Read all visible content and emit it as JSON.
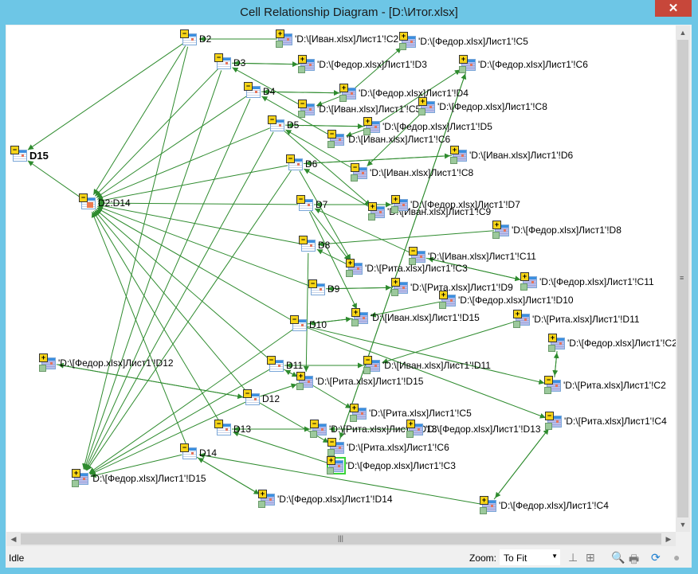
{
  "window": {
    "title": "Cell Relationship Diagram - [D:\\Итог.xlsx]",
    "close_label": "✕"
  },
  "colors": {
    "edge": "#2e8b2e",
    "titlebar": "#6dc6e6",
    "close": "#c7473a",
    "selection": "#3ad43a"
  },
  "nodes": [
    {
      "id": "D2",
      "label": "D2",
      "type": "local",
      "toggle": "−"
    },
    {
      "id": "IC2",
      "label": "'D:\\[Иван.xlsx]Лист1'!C2",
      "type": "ext",
      "toggle": "+"
    },
    {
      "id": "FC5",
      "label": "'D:\\[Федор.xlsx]Лист1'!C5",
      "type": "ext",
      "toggle": "+"
    },
    {
      "id": "D3",
      "label": "D3",
      "type": "local",
      "toggle": "−"
    },
    {
      "id": "FD3",
      "label": "'D:\\[Федор.xlsx]Лист1'!D3",
      "type": "ext",
      "toggle": "+"
    },
    {
      "id": "FC6",
      "label": "'D:\\[Федор.xlsx]Лист1'!C6",
      "type": "ext",
      "toggle": "+"
    },
    {
      "id": "D4",
      "label": "D4",
      "type": "local",
      "toggle": "−"
    },
    {
      "id": "FD4",
      "label": "'D:\\[Федор.xlsx]Лист1'!D4",
      "type": "ext",
      "toggle": "+"
    },
    {
      "id": "IC5",
      "label": "'D:\\[Иван.xlsx]Лист1'!C5",
      "type": "ext",
      "toggle": "−"
    },
    {
      "id": "FC8",
      "label": "'D:\\[Федор.xlsx]Лист1'!C8",
      "type": "ext",
      "toggle": "+"
    },
    {
      "id": "D5",
      "label": "D5",
      "type": "local",
      "toggle": "−"
    },
    {
      "id": "FD5",
      "label": "'D:\\[Федор.xlsx]Лист1'!D5",
      "type": "ext",
      "toggle": "+"
    },
    {
      "id": "IC6",
      "label": "'D:\\[Иван.xlsx]Лист1'!C6",
      "type": "ext",
      "toggle": "−"
    },
    {
      "id": "ID6",
      "label": "'D:\\[Иван.xlsx]Лист1'!D6",
      "type": "ext",
      "toggle": "+"
    },
    {
      "id": "D15",
      "label": "D15",
      "type": "root",
      "toggle": "−"
    },
    {
      "id": "D6",
      "label": "D6",
      "type": "local",
      "toggle": "−"
    },
    {
      "id": "IC8",
      "label": "'D:\\[Иван.xlsx]Лист1'!C8",
      "type": "ext",
      "toggle": "−"
    },
    {
      "id": "R",
      "label": "D2:D14",
      "type": "range",
      "toggle": "−"
    },
    {
      "id": "D7",
      "label": "D7",
      "type": "local",
      "toggle": "−"
    },
    {
      "id": "IC9",
      "label": "'D:\\[Иван.xlsx]Лист1'!C9",
      "type": "ext",
      "toggle": "+"
    },
    {
      "id": "FD7",
      "label": "'D:\\[Федор.xlsx]Лист1'!D7",
      "type": "ext",
      "toggle": "+"
    },
    {
      "id": "FD8",
      "label": "'D:\\[Федор.xlsx]Лист1'!D8",
      "type": "ext",
      "toggle": "+"
    },
    {
      "id": "D8",
      "label": "D8",
      "type": "local",
      "toggle": "−"
    },
    {
      "id": "IC11",
      "label": "'D:\\[Иван.xlsx]Лист1'!C11",
      "type": "ext",
      "toggle": "−"
    },
    {
      "id": "RC3",
      "label": "'D:\\[Рита.xlsx]Лист1'!C3",
      "type": "ext",
      "toggle": "+"
    },
    {
      "id": "FC11",
      "label": "'D:\\[Федор.xlsx]Лист1'!C11",
      "type": "ext",
      "toggle": "+"
    },
    {
      "id": "D9",
      "label": "D9",
      "type": "local",
      "toggle": "−"
    },
    {
      "id": "RD9",
      "label": "'D:\\[Рита.xlsx]Лист1'!D9",
      "type": "ext",
      "toggle": "+"
    },
    {
      "id": "FD10",
      "label": "'D:\\[Федор.xlsx]Лист1'!D10",
      "type": "ext",
      "toggle": "+"
    },
    {
      "id": "ID15",
      "label": "'D:\\[Иван.xlsx]Лист1'!D15",
      "type": "ext",
      "toggle": "+"
    },
    {
      "id": "D10",
      "label": "D10",
      "type": "local",
      "toggle": "−"
    },
    {
      "id": "RD11",
      "label": "'D:\\[Рита.xlsx]Лист1'!D11",
      "type": "ext",
      "toggle": "+"
    },
    {
      "id": "FC2",
      "label": "'D:\\[Федор.xlsx]Лист1'!C2",
      "type": "ext",
      "toggle": "+"
    },
    {
      "id": "FD12",
      "label": "'D:\\[Федор.xlsx]Лист1'!D12",
      "type": "ext",
      "toggle": "+"
    },
    {
      "id": "D11",
      "label": "D11",
      "type": "local",
      "toggle": "−"
    },
    {
      "id": "ID11",
      "label": "'D:\\[Иван.xlsx]Лист1'!D11",
      "type": "ext",
      "toggle": "−"
    },
    {
      "id": "RD15",
      "label": "'D:\\[Рита.xlsx]Лист1'!D15",
      "type": "ext",
      "toggle": "+"
    },
    {
      "id": "RC2",
      "label": "'D:\\[Рита.xlsx]Лист1'!C2",
      "type": "ext",
      "toggle": "−"
    },
    {
      "id": "D12",
      "label": "D12",
      "type": "local",
      "toggle": "−"
    },
    {
      "id": "RC5",
      "label": "'D:\\[Рита.xlsx]Лист1'!C5",
      "type": "ext",
      "toggle": "+"
    },
    {
      "id": "RC4",
      "label": "'D:\\[Рита.xlsx]Лист1'!C4",
      "type": "ext",
      "toggle": "−"
    },
    {
      "id": "D13",
      "label": "D13",
      "type": "local",
      "toggle": "−"
    },
    {
      "id": "RD13",
      "label": "'D:\\[Рита.xlsx]Лист1'!D13",
      "type": "ext",
      "toggle": "−"
    },
    {
      "id": "FD13",
      "label": "'D:\\[Федор.xlsx]Лист1'!D13",
      "type": "ext",
      "toggle": "+"
    },
    {
      "id": "RC6",
      "label": "'D:\\[Рита.xlsx]Лист1'!C6",
      "type": "ext",
      "toggle": "−"
    },
    {
      "id": "D14",
      "label": "D14",
      "type": "local",
      "toggle": "−"
    },
    {
      "id": "FC3",
      "label": "'D:\\[Федор.xlsx]Лист1'!C3",
      "type": "ext",
      "toggle": "+",
      "selected": true
    },
    {
      "id": "FD15",
      "label": "'D:\\[Федор.xlsx]Лист1'!D15",
      "type": "ext",
      "toggle": "+"
    },
    {
      "id": "FD14",
      "label": "'D:\\[Федор.xlsx]Лист1'!D14",
      "type": "ext",
      "toggle": "+"
    },
    {
      "id": "FC4",
      "label": "'D:\\[Федор.xlsx]Лист1'!C4",
      "type": "ext",
      "toggle": "+"
    }
  ],
  "edges": [
    [
      "D2",
      "D15"
    ],
    [
      "R",
      "D15"
    ],
    [
      "D2",
      "R"
    ],
    [
      "D3",
      "R"
    ],
    [
      "D4",
      "R"
    ],
    [
      "D5",
      "R"
    ],
    [
      "D6",
      "R"
    ],
    [
      "D7",
      "R"
    ],
    [
      "D8",
      "R"
    ],
    [
      "D9",
      "R"
    ],
    [
      "D10",
      "R"
    ],
    [
      "D11",
      "R"
    ],
    [
      "D12",
      "R"
    ],
    [
      "D13",
      "R"
    ],
    [
      "D14",
      "R"
    ],
    [
      "IC2",
      "D2"
    ],
    [
      "FD3",
      "D3"
    ],
    [
      "D3",
      "FD3"
    ],
    [
      "FD4",
      "D4"
    ],
    [
      "D4",
      "FD4"
    ],
    [
      "FD5",
      "D5"
    ],
    [
      "D5",
      "FD5"
    ],
    [
      "ID6",
      "D6"
    ],
    [
      "D6",
      "ID6"
    ],
    [
      "FD7",
      "D7"
    ],
    [
      "D7",
      "FD7"
    ],
    [
      "FD8",
      "D8"
    ],
    [
      "RD9",
      "D9"
    ],
    [
      "D9",
      "RD9"
    ],
    [
      "ID15",
      "D10"
    ],
    [
      "D10",
      "ID15"
    ],
    [
      "ID11",
      "D11"
    ],
    [
      "D11",
      "ID11"
    ],
    [
      "FD12",
      "D12"
    ],
    [
      "D12",
      "FD12"
    ],
    [
      "RD13",
      "D13"
    ],
    [
      "D13",
      "RD13"
    ],
    [
      "FD14",
      "D14"
    ],
    [
      "D14",
      "FD14"
    ],
    [
      "FD4",
      "IC5"
    ],
    [
      "FD4",
      "FC5"
    ],
    [
      "FD5",
      "IC6"
    ],
    [
      "FD5",
      "FC6"
    ],
    [
      "FC8",
      "IC8"
    ],
    [
      "IC5",
      "D3"
    ],
    [
      "IC6",
      "D4"
    ],
    [
      "IC8",
      "D5"
    ],
    [
      "IC9",
      "D6"
    ],
    [
      "IC11",
      "D7"
    ],
    [
      "RC3",
      "D8"
    ],
    [
      "FC11",
      "IC11"
    ],
    [
      "IC11",
      "FC11"
    ],
    [
      "FD10",
      "ID15"
    ],
    [
      "RD11",
      "ID11"
    ],
    [
      "FC2",
      "RC2"
    ],
    [
      "RC2",
      "FC2"
    ],
    [
      "RC4",
      "FC4"
    ],
    [
      "FC4",
      "RC4"
    ],
    [
      "RC6",
      "FC6"
    ],
    [
      "FC6",
      "RC6"
    ],
    [
      "D6",
      "RC3"
    ],
    [
      "D7",
      "ID15"
    ],
    [
      "D8",
      "RD15"
    ],
    [
      "D10",
      "RC2"
    ],
    [
      "D11",
      "RD15"
    ],
    [
      "RD15",
      "RC5"
    ],
    [
      "D12",
      "RD15"
    ],
    [
      "D12",
      "RC6"
    ],
    [
      "FC3",
      "D13"
    ],
    [
      "FC4",
      "D14"
    ],
    [
      "D10",
      "RC4"
    ],
    [
      "D5",
      "IC9"
    ],
    [
      "D7",
      "RC3"
    ],
    [
      "D3",
      "FD15"
    ],
    [
      "D4",
      "FD15"
    ],
    [
      "D5",
      "FD15"
    ],
    [
      "D6",
      "FD15"
    ],
    [
      "D10",
      "FD15"
    ],
    [
      "D11",
      "FD15"
    ],
    [
      "D12",
      "FD15"
    ],
    [
      "D14",
      "FD15"
    ],
    [
      "D2",
      "FD15"
    ],
    [
      "RD15",
      "D11"
    ],
    [
      "FD13",
      "RD13"
    ]
  ],
  "status": {
    "text": "Idle",
    "zoom_label": "Zoom:",
    "zoom_value": "To Fit",
    "tools": [
      "hierarchy-layout-icon",
      "grid-layout-icon",
      "print-preview-icon",
      "print-icon",
      "refresh-icon",
      "stop-icon"
    ]
  }
}
